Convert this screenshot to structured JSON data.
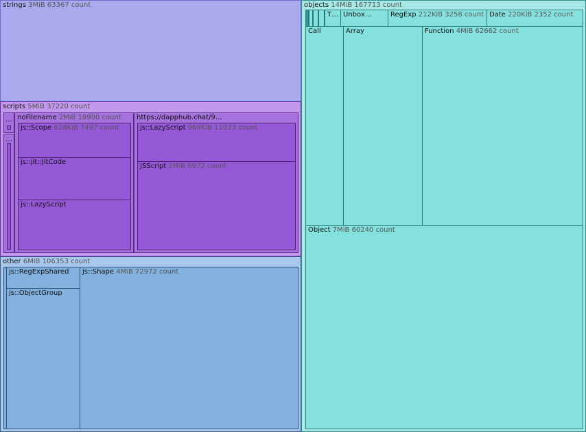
{
  "strings": {
    "name": "strings",
    "info": "3MiB 63367 count"
  },
  "scripts": {
    "name": "scripts",
    "info": "5MiB 37220 count",
    "tiny1": "…",
    "tiny2": "…",
    "noFilename": {
      "name": "noFilename",
      "info": "2MiB 18900 count",
      "scope": {
        "name": "js::Scope",
        "info": "628KiB 7497 count"
      },
      "jitcode": {
        "name": "js::jit::JitCode"
      },
      "lazyscript": {
        "name": "js::LazyScript"
      }
    },
    "dapphub": {
      "name": "https://dapphub.chat/9…",
      "lazyscript": {
        "name": "js::LazyScript",
        "info": "969KiB 11033 count"
      },
      "jsscript": {
        "name": "JSScript",
        "info": "2MiB 6972 count"
      }
    }
  },
  "other": {
    "name": "other",
    "info": "6MiB 106353 count",
    "regexpshared": {
      "name": "js::RegExpShared"
    },
    "objectgroup": {
      "name": "js::ObjectGroup"
    },
    "shape": {
      "name": "js::Shape",
      "info": "4MiB 72972 count"
    }
  },
  "objects": {
    "name": "objects",
    "info": "14MiB 167713 count",
    "t": {
      "name": "T…"
    },
    "unbox": {
      "name": "Unbox…"
    },
    "regexp": {
      "name": "RegExp",
      "info": "212KiB 3258 count"
    },
    "date": {
      "name": "Date",
      "info": "220KiB 2352 count"
    },
    "call": {
      "name": "Call"
    },
    "array": {
      "name": "Array"
    },
    "function": {
      "name": "Function",
      "info": "4MiB 62662 count"
    },
    "object": {
      "name": "Object",
      "info": "7MiB 60240 count"
    }
  }
}
